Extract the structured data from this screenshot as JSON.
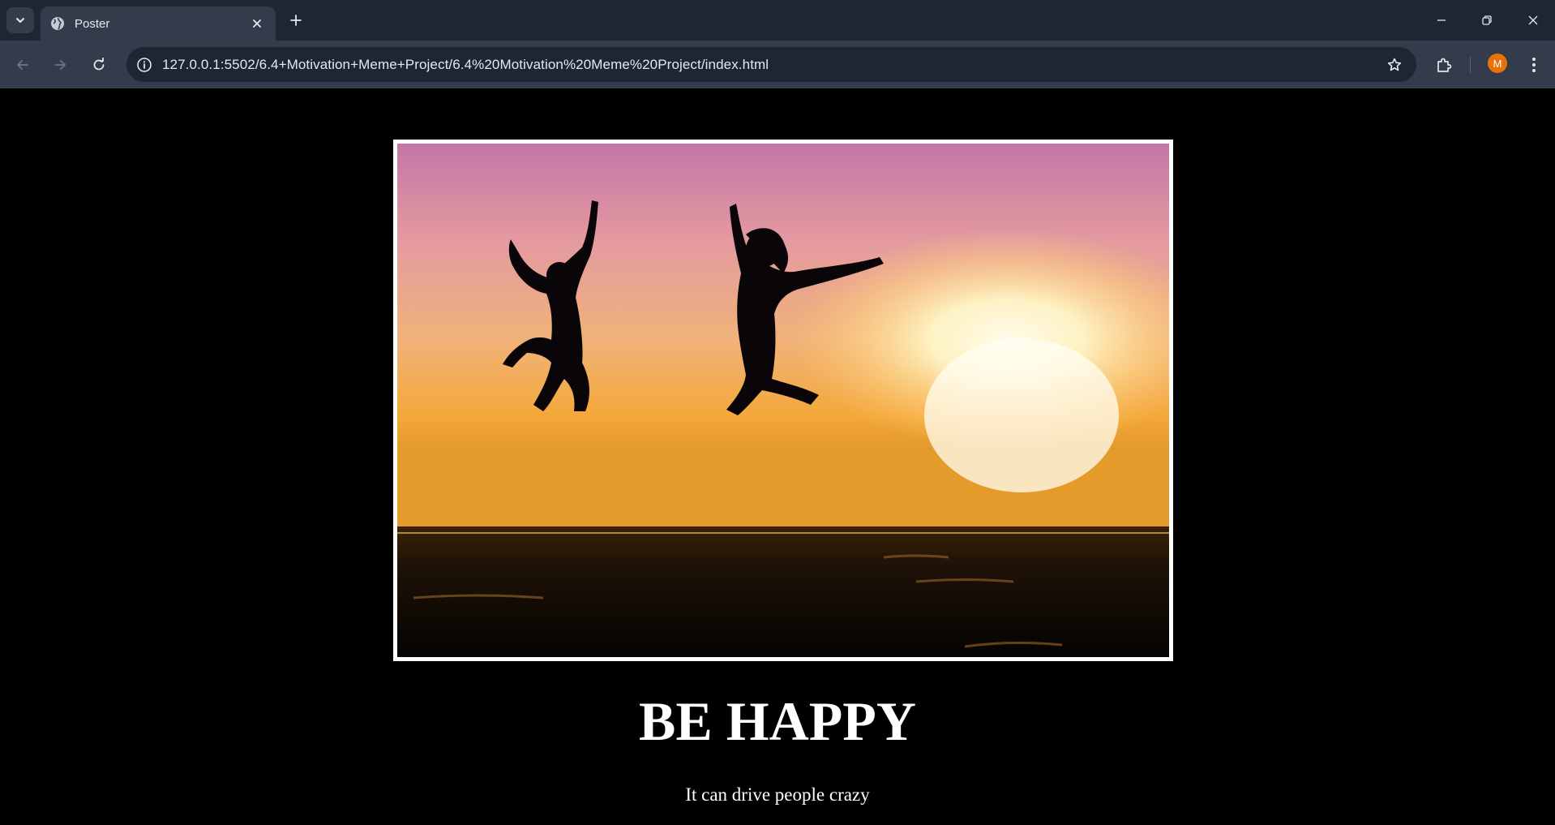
{
  "browser": {
    "tab_title": "Poster",
    "url": "127.0.0.1:5502/6.4+Motivation+Meme+Project/6.4%20Motivation%20Meme%20Project/index.html",
    "profile_initial": "M"
  },
  "poster": {
    "title": "BE HAPPY",
    "subtitle": "It can drive people crazy"
  },
  "colors": {
    "page_background": "#000000",
    "frame_border": "#ffffff",
    "tabstrip": "#1e2533",
    "toolbar": "#343c4c",
    "avatar": "#e8710a"
  }
}
